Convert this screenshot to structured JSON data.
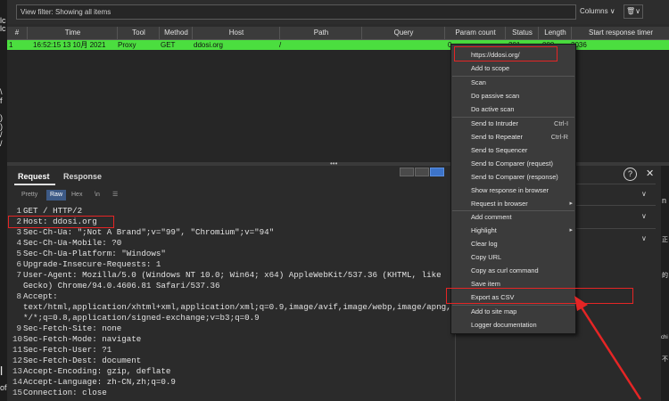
{
  "left_strip": [
    "lc",
    "lc",
    "\\",
    "f",
    ")",
    ")",
    "/",
    "/",
    "l",
    "of"
  ],
  "filter": {
    "value": "View filter: Showing all items",
    "columns_label": "Columns ∨",
    "trash_label": "🗑∨"
  },
  "table": {
    "columns": [
      "#",
      "Time",
      "Tool",
      "Method",
      "Host",
      "Path",
      "Query",
      "Param count",
      "Status",
      "Length",
      "Start response timer"
    ],
    "row": {
      "num": "1",
      "time": "16:52:15 13 10月 2021",
      "tool": "Proxy",
      "method": "GET",
      "host": "ddosi.org",
      "path": "/",
      "param_count": "0",
      "status": "301",
      "length": "000",
      "timer": "2036"
    }
  },
  "context_menu": {
    "url": "https://ddosi.org/",
    "items": [
      {
        "label": "Add to scope"
      },
      {
        "label": "Scan"
      },
      {
        "label": "Do passive scan"
      },
      {
        "label": "Do active scan"
      },
      {
        "label": "Send to Intruder",
        "shortcut": "Ctrl-I"
      },
      {
        "label": "Send to Repeater",
        "shortcut": "Ctrl-R"
      },
      {
        "label": "Send to Sequencer"
      },
      {
        "label": "Send to Comparer (request)"
      },
      {
        "label": "Send to Comparer (response)"
      },
      {
        "label": "Show response in browser"
      },
      {
        "label": "Request in browser"
      },
      {
        "label": "Add comment"
      },
      {
        "label": "Highlight"
      },
      {
        "label": "Clear log"
      },
      {
        "label": "Copy URL"
      },
      {
        "label": "Copy as curl command"
      },
      {
        "label": "Save item"
      },
      {
        "label": "Export as CSV"
      },
      {
        "label": "Add to site map"
      },
      {
        "label": "Logger documentation"
      }
    ]
  },
  "request_panel": {
    "tabs": [
      "Request",
      "Response"
    ],
    "sub_tabs": [
      "Pretty",
      "Raw",
      "Hex",
      "\\n",
      "☰"
    ],
    "lines": [
      {
        "n": "1",
        "t": "GET / HTTP/2"
      },
      {
        "n": "2",
        "t": "Host: ddosi.org"
      },
      {
        "n": "3",
        "t": "Sec-Ch-Ua: \";Not A Brand\";v=\"99\", \"Chromium\";v=\"94\""
      },
      {
        "n": "4",
        "t": "Sec-Ch-Ua-Mobile: ?0"
      },
      {
        "n": "5",
        "t": "Sec-Ch-Ua-Platform: \"Windows\""
      },
      {
        "n": "6",
        "t": "Upgrade-Insecure-Requests: 1"
      },
      {
        "n": "7",
        "t": "User-Agent: Mozilla/5.0 (Windows NT 10.0; Win64; x64) AppleWebKit/537.36 (KHTML, like"
      },
      {
        "n": "",
        "t": "Gecko) Chrome/94.0.4606.81 Safari/537.36"
      },
      {
        "n": "8",
        "t": "Accept:"
      },
      {
        "n": "",
        "t": "text/html,application/xhtml+xml,application/xml;q=0.9,image/avif,image/webp,image/apng,"
      },
      {
        "n": "",
        "t": "*/*;q=0.8,application/signed-exchange;v=b3;q=0.9"
      },
      {
        "n": "9",
        "t": "Sec-Fetch-Site: none"
      },
      {
        "n": "10",
        "t": "Sec-Fetch-Mode: navigate"
      },
      {
        "n": "11",
        "t": "Sec-Fetch-User: ?1"
      },
      {
        "n": "12",
        "t": "Sec-Fetch-Dest: document"
      },
      {
        "n": "13",
        "t": "Accept-Encoding: gzip, deflate"
      },
      {
        "n": "14",
        "t": "Accept-Language: zh-CN,zh;q=0.9"
      },
      {
        "n": "15",
        "t": "Connection: close"
      }
    ]
  },
  "right_panel": {
    "help_glyph": "?",
    "close_glyph": "✕",
    "chevron": "∨"
  },
  "right_edge_text": [
    "n",
    "正",
    "的",
    "chi",
    "不"
  ],
  "colors": {
    "highlight_row": "#4bde3f",
    "annotation": "#e52525",
    "raw_tab": "#3d5a86"
  }
}
